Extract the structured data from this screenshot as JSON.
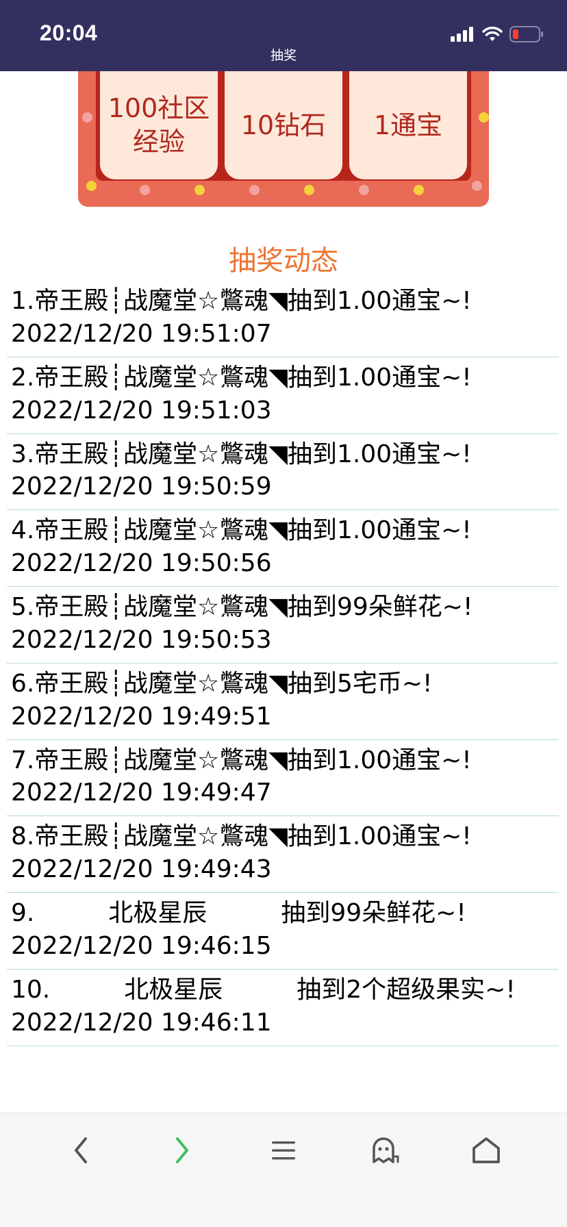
{
  "status_bar": {
    "time": "20:04",
    "page_title": "抽奖"
  },
  "prizes": [
    {
      "label": "100社区\n经验"
    },
    {
      "label": "10钻石"
    },
    {
      "label": "1通宝"
    }
  ],
  "section_title": "抽奖动态",
  "records": [
    {
      "text": "1.帝王殿┊战魔堂☆鷩魂◥抽到1.00通宝~!",
      "time": "2022/12/20 19:51:07"
    },
    {
      "text": "2.帝王殿┊战魔堂☆鷩魂◥抽到1.00通宝~!",
      "time": "2022/12/20 19:51:03"
    },
    {
      "text": "3.帝王殿┊战魔堂☆鷩魂◥抽到1.00通宝~!",
      "time": "2022/12/20 19:50:59"
    },
    {
      "text": "4.帝王殿┊战魔堂☆鷩魂◥抽到1.00通宝~!",
      "time": "2022/12/20 19:50:56"
    },
    {
      "text": "5.帝王殿┊战魔堂☆鷩魂◥抽到99朵鲜花~!",
      "time": "2022/12/20 19:50:53"
    },
    {
      "text": "6.帝王殿┊战魔堂☆鷩魂◥抽到5宅币~!",
      "time": "2022/12/20 19:49:51"
    },
    {
      "text": "7.帝王殿┊战魔堂☆鷩魂◥抽到1.00通宝~!",
      "time": "2022/12/20 19:49:47"
    },
    {
      "text": "8.帝王殿┊战魔堂☆鷩魂◥抽到1.00通宝~!",
      "time": "2022/12/20 19:49:43"
    },
    {
      "text": "9.　　　北极星辰　　　抽到99朵鲜花~!",
      "time": "2022/12/20 19:46:15"
    },
    {
      "text": "10.　　　北极星辰　　　抽到2个超级果实~!",
      "time": "2022/12/20 19:46:11"
    }
  ],
  "toolbar": {
    "icons": [
      "back-icon",
      "forward-icon",
      "menu-icon",
      "ghost-icon",
      "home-icon"
    ]
  },
  "colors": {
    "status_bar_bg": "#33305f",
    "accent_orange": "#ec7431",
    "prize_text": "#b0281d",
    "prize_frame": "#e96a55",
    "forward_green": "#3ebd5b"
  }
}
